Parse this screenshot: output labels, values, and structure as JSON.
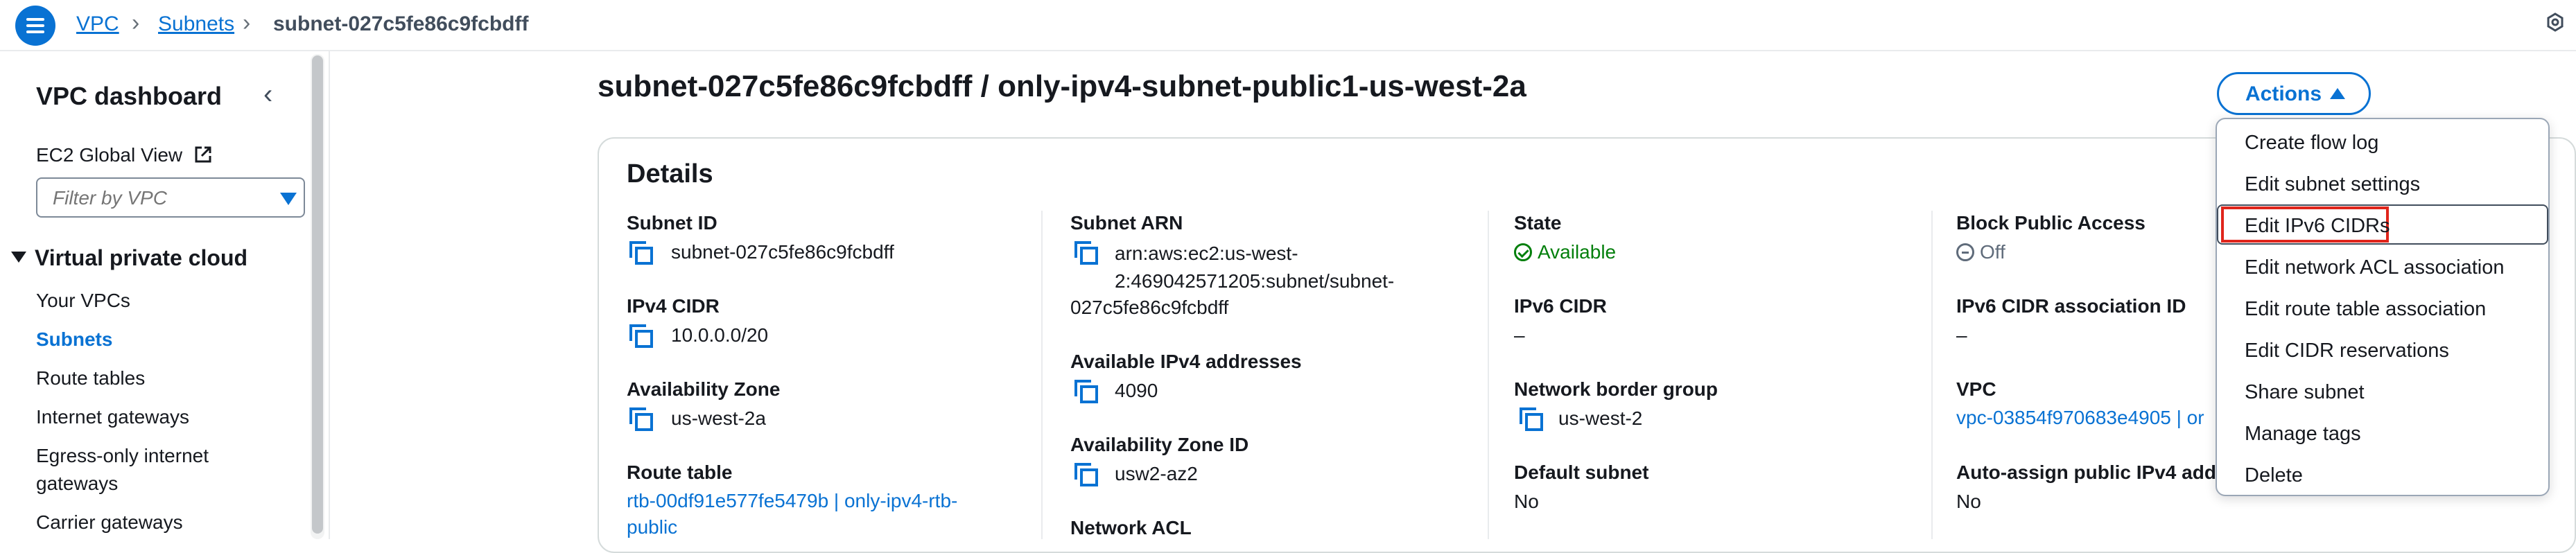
{
  "breadcrumb": {
    "vpc": "VPC",
    "subnets": "Subnets",
    "current": "subnet-027c5fe86c9fcbdff"
  },
  "sidebar": {
    "title": "VPC dashboard",
    "ec2_global_view": "EC2 Global View",
    "filter_placeholder": "Filter by VPC",
    "section": "Virtual private cloud",
    "items": [
      "Your VPCs",
      "Subnets",
      "Route tables",
      "Internet gateways",
      "Egress-only internet",
      "gateways",
      "Carrier gateways"
    ]
  },
  "page": {
    "title": "subnet-027c5fe86c9fcbdff / only-ipv4-subnet-public1-us-west-2a",
    "actions_label": "Actions"
  },
  "details": {
    "title": "Details",
    "subnet_id": {
      "label": "Subnet ID",
      "value": "subnet-027c5fe86c9fcbdff"
    },
    "ipv4_cidr": {
      "label": "IPv4 CIDR",
      "value": "10.0.0.0/20"
    },
    "availability_zone": {
      "label": "Availability Zone",
      "value": "us-west-2a"
    },
    "route_table": {
      "label": "Route table",
      "line1": "rtb-00df91e577fe5479b | only-ipv4-rtb-",
      "line2": "public"
    },
    "subnet_arn": {
      "label": "Subnet ARN",
      "line1": "arn:aws:ec2:us-west-",
      "line2": "2:469042571205:subnet/subnet-",
      "line3": "027c5fe86c9fcbdff"
    },
    "available_ipv4": {
      "label": "Available IPv4 addresses",
      "value": "4090"
    },
    "az_id": {
      "label": "Availability Zone ID",
      "value": "usw2-az2"
    },
    "network_acl": {
      "label": "Network ACL"
    },
    "state": {
      "label": "State",
      "value": "Available"
    },
    "ipv6_cidr": {
      "label": "IPv6 CIDR",
      "value": "–"
    },
    "network_border_group": {
      "label": "Network border group",
      "value": "us-west-2"
    },
    "default_subnet": {
      "label": "Default subnet",
      "value": "No"
    },
    "block_public_access": {
      "label": "Block Public Access",
      "value": "Off"
    },
    "ipv6_cidr_assoc": {
      "label": "IPv6 CIDR association ID",
      "value": "–"
    },
    "vpc": {
      "label": "VPC",
      "value": "vpc-03854f970683e4905 | or"
    },
    "auto_assign_ipv4": {
      "label": "Auto-assign public IPv4 addr",
      "value": "No"
    }
  },
  "actions_menu": [
    "Create flow log",
    "Edit subnet settings",
    "Edit IPv6 CIDRs",
    "Edit network ACL association",
    "Edit route table association",
    "Edit CIDR reservations",
    "Share subnet",
    "Manage tags",
    "Delete"
  ],
  "colors": {
    "accent": "#0972d3",
    "success": "#037f0c",
    "highlight": "#e0251b"
  }
}
